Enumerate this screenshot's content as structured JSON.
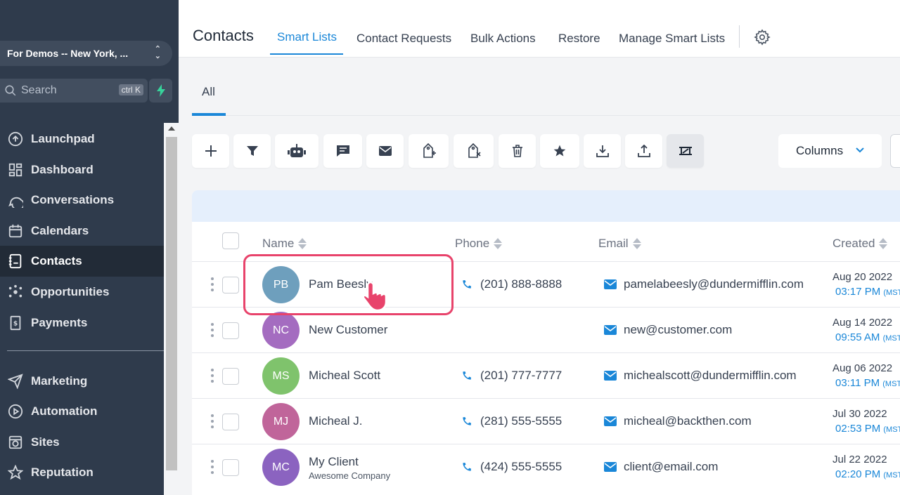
{
  "sidebar": {
    "location": "For Demos -- New York, ...",
    "search_placeholder": "Search",
    "search_shortcut": "ctrl K",
    "items": [
      {
        "label": "Launchpad",
        "icon": "launchpad-icon"
      },
      {
        "label": "Dashboard",
        "icon": "dashboard-icon"
      },
      {
        "label": "Conversations",
        "icon": "chat-bubble-icon"
      },
      {
        "label": "Calendars",
        "icon": "calendar-icon"
      },
      {
        "label": "Contacts",
        "icon": "contacts-icon",
        "active": true
      },
      {
        "label": "Opportunities",
        "icon": "opportunities-icon"
      },
      {
        "label": "Payments",
        "icon": "payments-icon"
      },
      {
        "label": "Marketing",
        "icon": "send-icon"
      },
      {
        "label": "Automation",
        "icon": "automation-icon"
      },
      {
        "label": "Sites",
        "icon": "globe-icon"
      },
      {
        "label": "Reputation",
        "icon": "star-icon"
      }
    ]
  },
  "header": {
    "title": "Contacts",
    "tabs": [
      "Smart Lists",
      "Contact Requests",
      "Bulk Actions",
      "Restore",
      "Manage Smart Lists"
    ],
    "active_tab": "Smart Lists"
  },
  "subtabs": [
    "All"
  ],
  "toolbar": {
    "buttons": [
      "add-icon",
      "filter-icon",
      "robot-icon",
      "message-icon",
      "email-icon",
      "add-tag-icon",
      "remove-tag-icon",
      "trash-icon",
      "star-icon",
      "import-icon",
      "export-icon",
      "merge-icon"
    ],
    "columns_label": "Columns"
  },
  "table": {
    "headers": [
      "Name",
      "Phone",
      "Email",
      "Created"
    ],
    "rows": [
      {
        "initials": "PB",
        "name": "Pam Beesly",
        "company": "",
        "phone": "(201) 888-8888",
        "email": "pamelabeesly@dundermifflin.com",
        "date": "Aug 20 2022",
        "time": "03:17 PM",
        "tz": "(MST",
        "avatar_color": "#6e9fbd"
      },
      {
        "initials": "NC",
        "name": "New Customer",
        "company": "",
        "phone": "",
        "email": "new@customer.com",
        "date": "Aug 14 2022",
        "time": "09:55 AM",
        "tz": "(MST",
        "avatar_color": "#a46cc0"
      },
      {
        "initials": "MS",
        "name": "Micheal Scott",
        "company": "",
        "phone": "(201) 777-7777",
        "email": "michealscott@dundermifflin.com",
        "date": "Aug 06 2022",
        "time": "03:11 PM",
        "tz": "(MST",
        "avatar_color": "#7fc36c"
      },
      {
        "initials": "MJ",
        "name": "Micheal J.",
        "company": "",
        "phone": "(281) 555-5555",
        "email": "micheal@backthen.com",
        "date": "Jul 30 2022",
        "time": "02:53 PM",
        "tz": "(MST",
        "avatar_color": "#c0659a"
      },
      {
        "initials": "MC",
        "name": "My Client",
        "company": "Awesome Company",
        "phone": "(424) 555-5555",
        "email": "client@email.com",
        "date": "Jul 22 2022",
        "time": "02:20 PM",
        "tz": "(MST",
        "avatar_color": "#8b63c0"
      }
    ]
  },
  "colors": {
    "accent": "#1a87d8",
    "sidebar_bg": "#2f3b4c",
    "highlight": "#e8436b"
  }
}
